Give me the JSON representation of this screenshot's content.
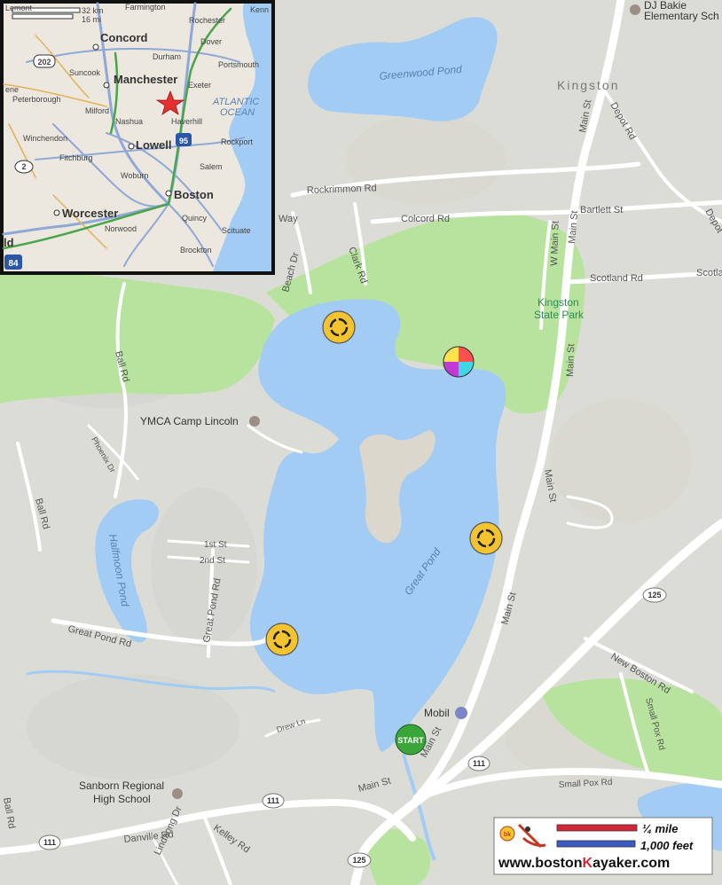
{
  "map": {
    "labels": {
      "kingston": "Kingston",
      "dj_bakie": "DJ Bakie",
      "dj_bakie_2": "Elementary Sch",
      "greenwood_pond": "Greenwood Pond",
      "great_pond": "Great Pond",
      "halfmoon_pond": "Halfmoon Pond",
      "kingston_state_park": "Kingston",
      "kingston_state_park_2": "State Park",
      "ymca": "YMCA Camp Lincoln",
      "sanborn": "Sanborn Regional",
      "sanborn_2": "High School",
      "mobil": "Mobil",
      "start": "START"
    },
    "roads": {
      "rockrimmon": "Rockrimmon Rd",
      "colcord": "Colcord Rd",
      "bartlett": "Bartlett St",
      "scotland": "Scotland Rd",
      "scotla": "Scotla",
      "depot": "Depot Rd",
      "depot2": "Depot",
      "main_st_top": "Main St",
      "w_main": "W Main St",
      "main_st_mid": "Main St",
      "main_st_low": "Main St",
      "main_st_south": "Main St",
      "main_st_west": "Main St",
      "clark": "Clark Rd",
      "beach": "Beach Dr",
      "way": "Way",
      "ball_rd": "Ball Rd",
      "ball_rd2": "Ball Rd",
      "ball_rd3": "Ball Rd",
      "phoenix": "Phoenix Dr",
      "first_st": "1st St",
      "second_st": "2nd St",
      "great_pond_rd": "Great Pond Rd",
      "great_pond_rd2": "Great Pond Rd",
      "drew": "Drew Ln",
      "new_boston": "New Boston Rd",
      "small_pox": "Small Pox Rd",
      "small_pox2": "Small Pox Rd",
      "danville": "Danville Rd",
      "kelley": "Kelley Rd",
      "lindsong": "Lindsong Dr",
      "route_111a": "111",
      "route_111b": "111",
      "route_111c": "111",
      "route_125a": "125",
      "route_125b": "125"
    }
  },
  "inset": {
    "scale_km": "32 km",
    "scale_mi": "16 mi",
    "cities": {
      "concord": "Concord",
      "manchester": "Manchester",
      "lowell": "Lowell",
      "boston": "Boston",
      "worcester": "Worcester"
    },
    "towns": {
      "farmington": "Farmington",
      "rochester": "Rochester",
      "kenn": "Kenn",
      "lemont": "Lemont",
      "dover": "Dover",
      "durham": "Durham",
      "portsmouth": "Portsmouth",
      "suncook": "Suncook",
      "exeter": "Exeter",
      "peterborough": "Peterborough",
      "milford": "Milford",
      "nashua": "Nashua",
      "haverhill": "Haverhill",
      "winchendon": "Winchendon",
      "rockport": "Rockport",
      "fitchburg": "Fitchburg",
      "salem": "Salem",
      "woburn": "Woburn",
      "quincy": "Quincy",
      "norwood": "Norwood",
      "scituate": "Scituate",
      "brockton": "Brockton",
      "ene": "ene",
      "ld": "ld"
    },
    "ocean": "ATLANTIC",
    "ocean_2": "OCEAN",
    "shields": {
      "us202": "202",
      "i95": "95",
      "i84": "84",
      "r2": "2"
    }
  },
  "legend": {
    "quarter_mile": "¼ mile",
    "thousand_feet": "1,000 feet",
    "url_prefix": "www.boston",
    "url_k": "K",
    "url_suffix": "ayaker.com",
    "logo": "bk"
  },
  "colors": {
    "water": "#a3ccf4",
    "park": "#b8e39e",
    "land": "#dcdcd6",
    "road": "#ffffff",
    "start": "#3aa63a",
    "marker": "#f4c430",
    "accent_red": "#cc2233"
  }
}
